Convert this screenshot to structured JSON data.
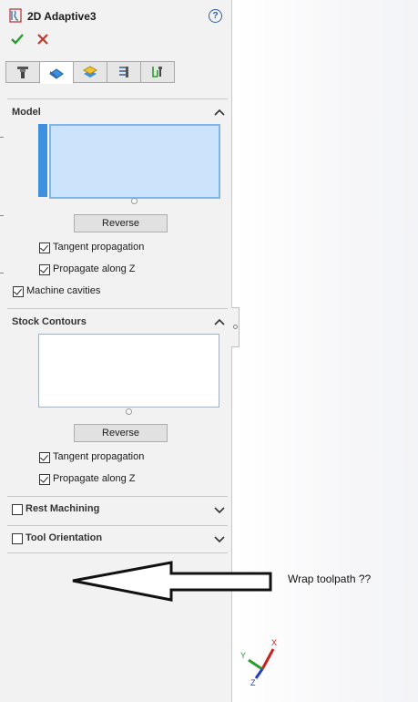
{
  "panel": {
    "title": "2D Adaptive3",
    "help_symbol": "?",
    "ok_icon": "checkmark-icon",
    "cancel_icon": "x-icon",
    "tabs": [
      {
        "name": "tool-tab",
        "icon": "tool-icon"
      },
      {
        "name": "geometry-tab",
        "icon": "geometry-icon",
        "active": true
      },
      {
        "name": "heights-tab",
        "icon": "heights-icon"
      },
      {
        "name": "passes-tab",
        "icon": "passes-icon"
      },
      {
        "name": "linking-tab",
        "icon": "linking-icon"
      }
    ]
  },
  "model": {
    "title": "Model",
    "reverse_label": "Reverse",
    "tangent_label": "Tangent propagation",
    "tangent_checked": true,
    "propagate_label": "Propagate along Z",
    "propagate_checked": true,
    "cavities_label": "Machine cavities",
    "cavities_checked": true
  },
  "stock": {
    "title": "Stock Contours",
    "reverse_label": "Reverse",
    "tangent_label": "Tangent propagation",
    "tangent_checked": true,
    "propagate_label": "Propagate along Z",
    "propagate_checked": true
  },
  "rest": {
    "label": "Rest Machining",
    "checked": false
  },
  "orientation": {
    "label": "Tool Orientation",
    "checked": false
  },
  "annotation": {
    "text": "Wrap toolpath ??"
  },
  "triad": {
    "x": "X",
    "y": "Y",
    "z": "Z"
  },
  "colors": {
    "accent": "#3d8fe0",
    "ok": "#2a9d2a",
    "cancel": "#c0392b",
    "selection": "#cce4fb"
  }
}
